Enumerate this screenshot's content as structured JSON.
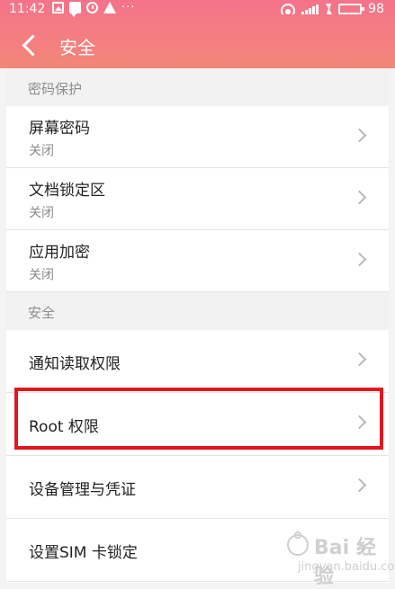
{
  "status": {
    "time": "11:42",
    "left_icons": [
      "image-icon",
      "chat-icon",
      "clock-icon",
      "warning-icon",
      "more-icon"
    ],
    "battery_level": "98",
    "charging": true
  },
  "nav": {
    "title": "安全"
  },
  "sections": [
    {
      "header": "密码保护",
      "items": [
        {
          "title": "屏幕密码",
          "subtitle": "关闭"
        },
        {
          "title": "文档锁定区",
          "subtitle": "关闭"
        },
        {
          "title": "应用加密",
          "subtitle": "关闭"
        }
      ]
    },
    {
      "header": "安全",
      "items": [
        {
          "title": "通知读取权限"
        },
        {
          "title": "Root 权限"
        },
        {
          "title": "设备管理与凭证"
        },
        {
          "title": "设置SIM 卡锁定"
        }
      ]
    }
  ],
  "watermark": {
    "main": "Bai 经验",
    "sub": "jingyan.baidu.com"
  },
  "colors": {
    "header_top": "#f5738a",
    "header_bottom": "#f38779",
    "highlight": "#e0181f",
    "battery": "#36c12d"
  }
}
